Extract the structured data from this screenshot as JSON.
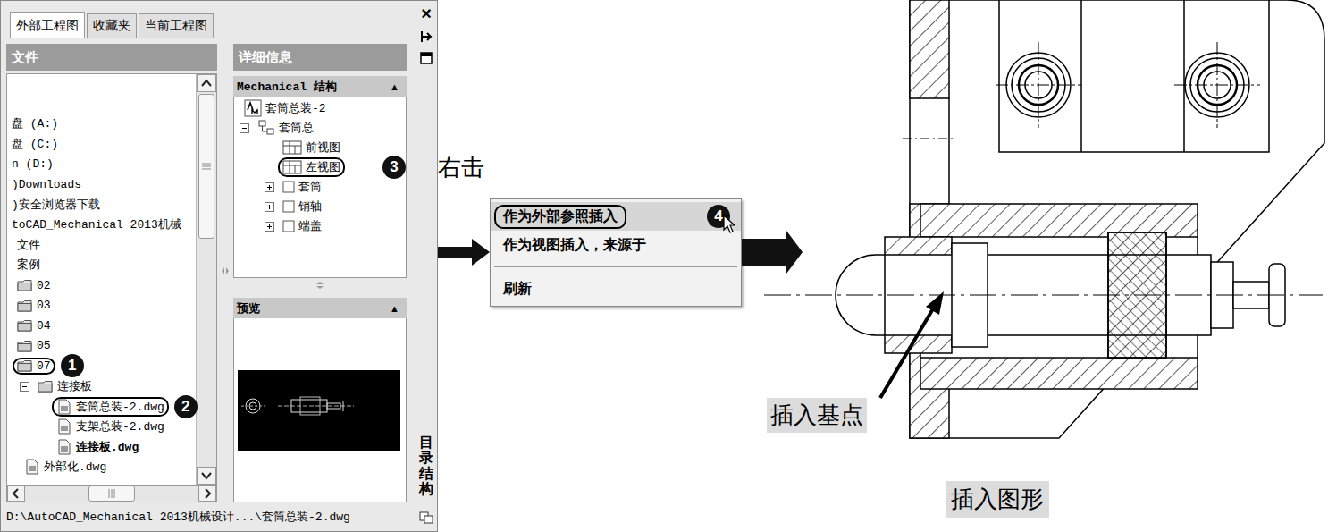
{
  "panel": {
    "tabs": [
      {
        "label": "外部工程图",
        "selected": true
      },
      {
        "label": "收藏夹",
        "selected": false
      },
      {
        "label": "当前工程图",
        "selected": false
      }
    ],
    "close_glyph": "×",
    "side_label": "目录结构",
    "files": {
      "header": "文件",
      "items": [
        {
          "label": "盘 (A:)",
          "depth": 0,
          "kind": "drive",
          "expandable": false,
          "expanded": false,
          "open": false,
          "callout": ""
        },
        {
          "label": "盘 (C:)",
          "depth": 0,
          "kind": "drive",
          "expandable": false,
          "expanded": false,
          "open": false,
          "callout": ""
        },
        {
          "label": "n (D:)",
          "depth": 0,
          "kind": "drive",
          "expandable": false,
          "expanded": false,
          "open": false,
          "callout": ""
        },
        {
          "label": ")Downloads",
          "depth": 0,
          "kind": "drive",
          "expandable": false,
          "expanded": false,
          "open": false,
          "callout": ""
        },
        {
          "label": ")安全浏览器下载",
          "depth": 0,
          "kind": "drive",
          "expandable": false,
          "expanded": false,
          "open": false,
          "callout": ""
        },
        {
          "label": "toCAD_Mechanical 2013机械",
          "depth": 0,
          "kind": "drive",
          "expandable": false,
          "expanded": false,
          "open": false,
          "callout": ""
        },
        {
          "label": "文件",
          "depth": 1,
          "kind": "plain",
          "expandable": false,
          "expanded": false,
          "open": false,
          "callout": ""
        },
        {
          "label": "案例",
          "depth": 1,
          "kind": "plain",
          "expandable": false,
          "expanded": false,
          "open": false,
          "callout": ""
        },
        {
          "label": "02",
          "depth": 1,
          "kind": "folder",
          "expandable": false,
          "expanded": false,
          "open": false,
          "callout": ""
        },
        {
          "label": "03",
          "depth": 1,
          "kind": "folder",
          "expandable": false,
          "expanded": false,
          "open": false,
          "callout": ""
        },
        {
          "label": "04",
          "depth": 1,
          "kind": "folder",
          "expandable": false,
          "expanded": false,
          "open": false,
          "callout": ""
        },
        {
          "label": "05",
          "depth": 1,
          "kind": "folder",
          "expandable": false,
          "expanded": false,
          "open": false,
          "callout": ""
        },
        {
          "label": "07",
          "depth": 1,
          "kind": "folder",
          "expandable": false,
          "expanded": true,
          "open": false,
          "callout": "1"
        },
        {
          "label": "连接板",
          "depth": 2,
          "kind": "folder",
          "expandable": true,
          "expanded": true,
          "open": false,
          "callout": ""
        },
        {
          "label": "套筒总装-2.dwg",
          "depth": 3,
          "kind": "file",
          "expandable": false,
          "expanded": false,
          "open": false,
          "callout": "2"
        },
        {
          "label": "支架总装-2.dwg",
          "depth": 3,
          "kind": "file",
          "expandable": false,
          "expanded": false,
          "open": false,
          "callout": ""
        },
        {
          "label": "连接板.dwg",
          "depth": 3,
          "kind": "file",
          "expandable": false,
          "expanded": false,
          "open": true,
          "callout": ""
        },
        {
          "label": "外部化.dwg",
          "depth": 2,
          "kind": "file",
          "expandable": false,
          "expanded": false,
          "open": false,
          "callout": ""
        }
      ]
    },
    "details": {
      "header": "详细信息",
      "structure_title": "Mechanical 结构",
      "collapse_glyph": "▲",
      "items": [
        {
          "label": "套筒总装-2",
          "depth": 0,
          "kind": "drawing",
          "expandable": false,
          "expanded": false,
          "callout": "",
          "note": ""
        },
        {
          "label": "套筒总",
          "depth": 0,
          "kind": "assembly",
          "expandable": true,
          "expanded": true,
          "callout": "",
          "note": ""
        },
        {
          "label": "前视图",
          "depth": 1,
          "kind": "view",
          "expandable": false,
          "expanded": false,
          "callout": "",
          "note": ""
        },
        {
          "label": "左视图",
          "depth": 1,
          "kind": "view",
          "expandable": false,
          "expanded": false,
          "callout": "3",
          "note": "右击"
        },
        {
          "label": "套筒",
          "depth": 1,
          "kind": "part",
          "expandable": true,
          "expanded": false,
          "callout": "",
          "note": ""
        },
        {
          "label": "销轴",
          "depth": 1,
          "kind": "part",
          "expandable": true,
          "expanded": false,
          "callout": "",
          "note": ""
        },
        {
          "label": "端盖",
          "depth": 1,
          "kind": "part",
          "expandable": true,
          "expanded": false,
          "callout": "",
          "note": ""
        }
      ],
      "preview_title": "预览"
    },
    "status_path": "D:\\AutoCAD_Mechanical 2013机械设计...\\套筒总装-2.dwg"
  },
  "context_menu": {
    "items": [
      {
        "label": "作为外部参照插入",
        "selected": true,
        "separator_before": false,
        "callout": "4"
      },
      {
        "label": "作为视图插入，来源于",
        "selected": false,
        "separator_before": false,
        "callout": ""
      },
      {
        "label": "刷新",
        "selected": false,
        "separator_before": true,
        "callout": ""
      }
    ]
  },
  "drawing": {
    "base_point_label": "插入基点",
    "caption": "插入图形"
  }
}
